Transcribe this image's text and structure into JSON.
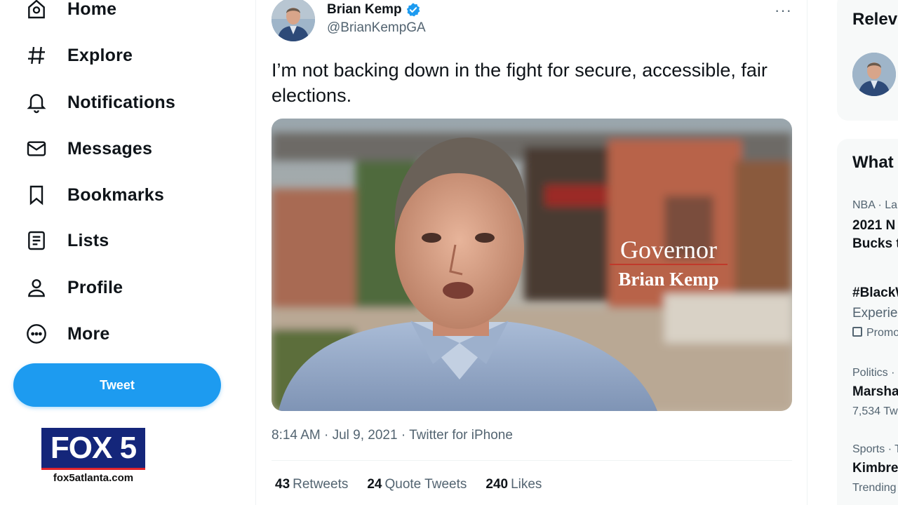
{
  "nav": {
    "items": [
      {
        "label": "Home",
        "icon": "home-icon"
      },
      {
        "label": "Explore",
        "icon": "hashtag-icon"
      },
      {
        "label": "Notifications",
        "icon": "bell-icon"
      },
      {
        "label": "Messages",
        "icon": "envelope-icon"
      },
      {
        "label": "Bookmarks",
        "icon": "bookmark-icon"
      },
      {
        "label": "Lists",
        "icon": "list-icon"
      },
      {
        "label": "Profile",
        "icon": "person-icon"
      },
      {
        "label": "More",
        "icon": "more-circle-icon"
      }
    ],
    "tweet_button": "Tweet"
  },
  "watermark": {
    "logo_text": "FOX 5",
    "url": "fox5atlanta.com"
  },
  "tweet": {
    "author_name": "Brian Kemp",
    "handle": "@BrianKempGA",
    "text": "I’m not backing down in the fight for secure, accessible, fair elections.",
    "media_overlay": {
      "line1": "Governor",
      "line2": "Brian Kemp"
    },
    "meta": "8:14 AM · Jul 9, 2021 · Twitter for iPhone",
    "stats": {
      "retweets_count": "43",
      "retweets_label": "Retweets",
      "quotes_count": "24",
      "quotes_label": "Quote Tweets",
      "likes_count": "240",
      "likes_label": "Likes"
    },
    "more_menu": "···"
  },
  "right": {
    "relevant_title": "Relev",
    "trends_title": "What",
    "trends": [
      {
        "context": "NBA · La",
        "title_lines": [
          "2021 N",
          "Bucks t"
        ]
      },
      {
        "context": "",
        "title_lines": [
          "#BlackW"
        ],
        "sub": "Experien",
        "promo": "Promo"
      },
      {
        "context": "Politics ·",
        "title_lines": [
          "Marsha"
        ],
        "sub": "7,534 Tw"
      },
      {
        "context": "Sports · T",
        "title_lines": [
          "Kimbre"
        ],
        "sub": "Trending"
      }
    ]
  },
  "colors": {
    "accent": "#1d9bf0",
    "text": "#0f1419",
    "secondary": "#536471",
    "fox_blue": "#14267a",
    "fox_red": "#e0242c"
  }
}
